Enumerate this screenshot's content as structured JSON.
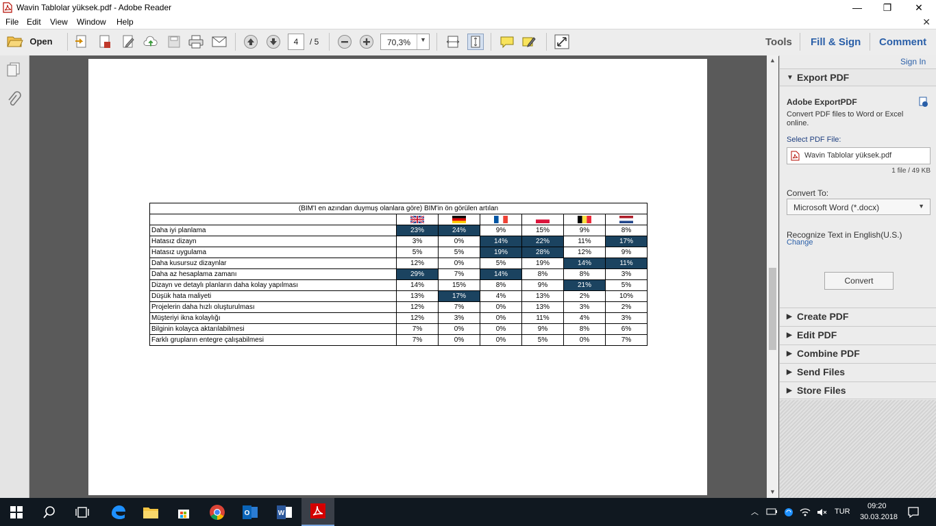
{
  "window": {
    "title": "Wavin Tablolar yüksek.pdf - Adobe Reader",
    "minimize": "—",
    "maximize": "❐",
    "close": "✕"
  },
  "menu": [
    "File",
    "Edit",
    "View",
    "Window",
    "Help"
  ],
  "toolbar": {
    "open_label": "Open",
    "current_page": "4",
    "page_total": "/ 5",
    "zoom": "70,3%",
    "tools_label": "Tools",
    "fill_sign_label": "Fill & Sign",
    "comment_label": "Comment"
  },
  "table": {
    "title": "(BIM'I en azından duymuş olanlara göre) BIM'in ön görülen artılan",
    "flags": [
      "uk-flag",
      "germany-flag",
      "france-flag",
      "poland-flag",
      "belgium-flag",
      "netherlands-flag"
    ],
    "rows": [
      {
        "label": "Daha iyi planlama",
        "values": [
          "23%",
          "24%",
          "9%",
          "15%",
          "9%",
          "8%"
        ],
        "hl": [
          0,
          1
        ]
      },
      {
        "label": "Hatasız dizayn",
        "values": [
          "3%",
          "0%",
          "14%",
          "22%",
          "11%",
          "17%"
        ],
        "hl": [
          2,
          3,
          5
        ]
      },
      {
        "label": "Hatasız uygulama",
        "values": [
          "5%",
          "5%",
          "19%",
          "28%",
          "12%",
          "9%"
        ],
        "hl": [
          2,
          3
        ]
      },
      {
        "label": "Daha kusursuz dizaynlar",
        "values": [
          "12%",
          "0%",
          "5%",
          "19%",
          "14%",
          "11%"
        ],
        "hl": [
          4,
          5
        ]
      },
      {
        "label": "Daha az hesaplama zamanı",
        "values": [
          "29%",
          "7%",
          "14%",
          "8%",
          "8%",
          "3%"
        ],
        "hl": [
          0,
          2
        ]
      },
      {
        "label": "Dizayn ve detaylı planların daha kolay yapılması",
        "values": [
          "14%",
          "15%",
          "8%",
          "9%",
          "21%",
          "5%"
        ],
        "hl": [
          4
        ]
      },
      {
        "label": "Düşük hata maliyeti",
        "values": [
          "13%",
          "17%",
          "4%",
          "13%",
          "2%",
          "10%"
        ],
        "hl": [
          1
        ]
      },
      {
        "label": "Projelerin daha hızlı oluşturulması",
        "values": [
          "12%",
          "7%",
          "0%",
          "13%",
          "3%",
          "2%"
        ],
        "hl": []
      },
      {
        "label": "Müşteriyi ikna kolaylığı",
        "values": [
          "12%",
          "3%",
          "0%",
          "11%",
          "4%",
          "3%"
        ],
        "hl": []
      },
      {
        "label": "Bilginin kolayca aktarılabilmesi",
        "values": [
          "7%",
          "0%",
          "0%",
          "9%",
          "8%",
          "6%"
        ],
        "hl": []
      },
      {
        "label": "Farklı grupların entegre çalışabilmesi",
        "values": [
          "7%",
          "0%",
          "0%",
          "5%",
          "0%",
          "7%"
        ],
        "hl": []
      }
    ]
  },
  "right_panel": {
    "sign_in": "Sign In",
    "export_header": "Export PDF",
    "service_title": "Adobe ExportPDF",
    "description": "Convert PDF files to Word or Excel online.",
    "select_label": "Select PDF File:",
    "file_name": "Wavin Tablolar yüksek.pdf",
    "file_info": "1 file / 49 KB",
    "convert_to_label": "Convert To:",
    "convert_to_value": "Microsoft Word (*.docx)",
    "recognize_text": "Recognize Text in English(U.S.)",
    "change_link": "Change",
    "convert_button": "Convert",
    "sections": [
      "Create PDF",
      "Edit PDF",
      "Combine PDF",
      "Send Files",
      "Store Files"
    ]
  },
  "taskbar": {
    "language": "TUR",
    "time": "09:20",
    "date": "30.03.2018"
  },
  "colors": {
    "highlight": "#1b4360",
    "link": "#2a5fa8",
    "taskbar": "#101820"
  }
}
